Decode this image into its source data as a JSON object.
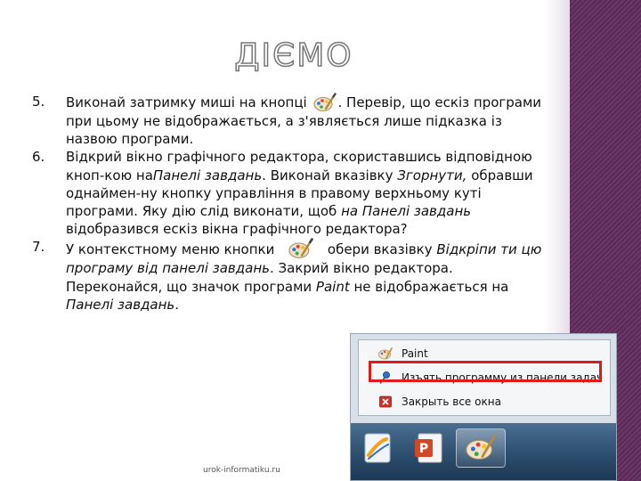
{
  "title": "ДІЄМО",
  "items": [
    {
      "number": "5.",
      "before": "Виконай затримку миші на кнопці",
      "after": ". Перевір, що ескіз програми при цьому не відображається, а з'являється лише підказка із назвою програми."
    },
    {
      "number": "6.",
      "part1": "Відкрий вікно графічного редактора, скориставшись відповідною кноп-кою на",
      "italic1": "Панелі завдань",
      "part2": ". Виконай вказівку",
      "italic2": "Згорнути,",
      "part3": "обравши однаймен-ну кнопку управління в правому верхньому куті програми. Яку дію слід виконати, щоб",
      "italic3": "на Панелі завдань",
      "part4": "відобразився ескіз вікна графічного редактора?"
    },
    {
      "number": "7.",
      "part1": "У контекстному меню кнопки",
      "part2": "обери вказівку",
      "italic1": "Відкріпи ти цю програму від панелі завдань",
      "part3": ". Закрий вікно редактора. Переконайся, що значок програми",
      "italic2": "Paint",
      "part4": "не відображається на",
      "italic3": "Панелі завдань",
      "part5": "."
    }
  ],
  "context_menu": {
    "items": [
      {
        "label": "Paint",
        "icon": "paint-icon"
      },
      {
        "label": "Изъять программу из панели задач",
        "icon": "unpin-icon",
        "highlighted": true
      },
      {
        "label": "Закрыть все окна",
        "icon": "close-window-icon"
      }
    ],
    "highlight_color": "#e01b1b"
  },
  "taskbar": {
    "buttons": [
      {
        "icon": "editor-icon"
      },
      {
        "icon": "powerpoint-icon"
      },
      {
        "icon": "paint-icon",
        "active": true
      }
    ]
  },
  "footer": "urok-informatiku.ru",
  "colors": {
    "side_panel": "#5a2a57",
    "title_outline": "#777777"
  }
}
